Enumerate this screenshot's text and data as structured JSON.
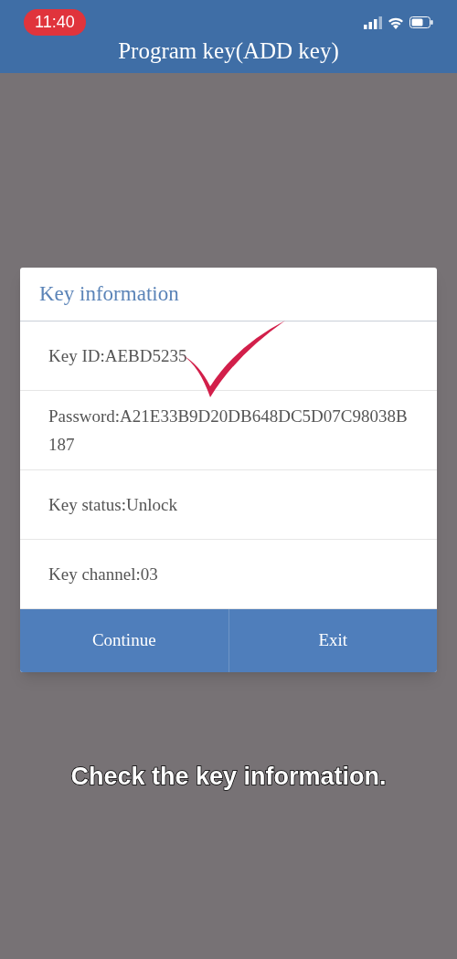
{
  "status_bar": {
    "time": "11:40"
  },
  "header": {
    "title": "Program key(ADD key)"
  },
  "dialog": {
    "title": "Key information",
    "rows": [
      {
        "text": "Key ID:AEBD5235"
      },
      {
        "text": "Password:A21E33B9D20DB648DC5D07C98038B187"
      },
      {
        "text": "Key status:Unlock"
      },
      {
        "text": "Key channel:03"
      }
    ],
    "buttons": [
      "Continue",
      "Exit"
    ]
  },
  "caption": "Check the key information."
}
